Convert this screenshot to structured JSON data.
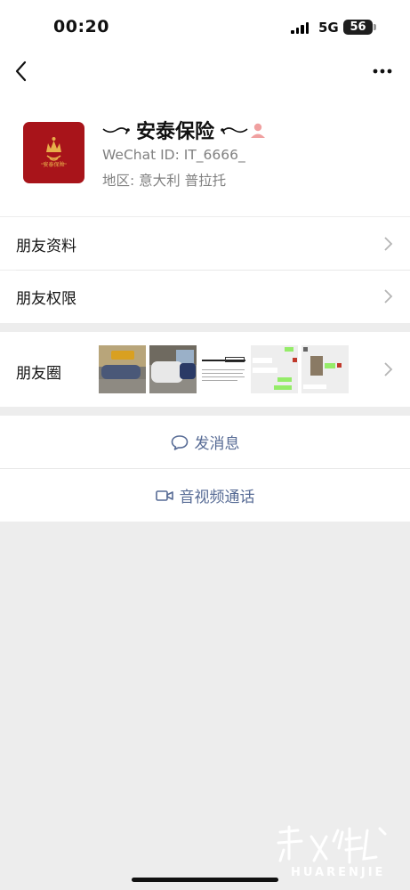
{
  "status_bar": {
    "time": "00:20",
    "network": "5G",
    "battery": "56"
  },
  "profile": {
    "name": "安泰保险",
    "wechat_id": "WeChat ID: IT_6666_",
    "region": "地区: 意大利 普拉托",
    "avatar_text": "安泰保险"
  },
  "menu": {
    "friend_info": "朋友资料",
    "friend_permissions": "朋友权限",
    "moments": "朋友圈"
  },
  "actions": {
    "send_message": "发消息",
    "voice_video_call": "音视频通话"
  },
  "watermark": {
    "logo_text": "华人街",
    "sub_text": "HUARENJIE"
  },
  "colors": {
    "link": "#576b95",
    "avatar_bg": "#a8141a",
    "page_bg": "#ededed"
  }
}
